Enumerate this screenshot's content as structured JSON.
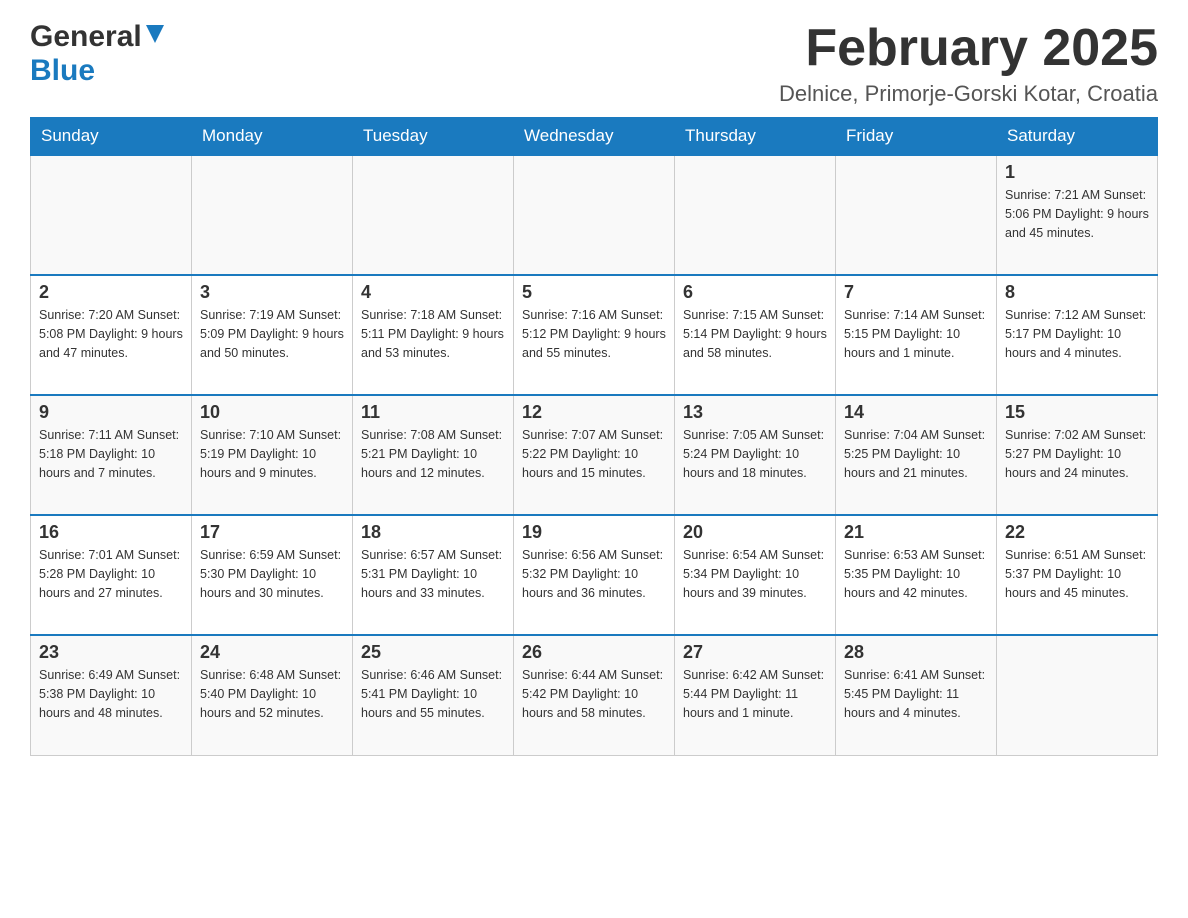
{
  "header": {
    "logo_line1": "General",
    "logo_triangle": "▶",
    "logo_line2": "Blue",
    "month_title": "February 2025",
    "location": "Delnice, Primorje-Gorski Kotar, Croatia"
  },
  "days_of_week": [
    "Sunday",
    "Monday",
    "Tuesday",
    "Wednesday",
    "Thursday",
    "Friday",
    "Saturday"
  ],
  "weeks": [
    [
      {
        "day": "",
        "info": ""
      },
      {
        "day": "",
        "info": ""
      },
      {
        "day": "",
        "info": ""
      },
      {
        "day": "",
        "info": ""
      },
      {
        "day": "",
        "info": ""
      },
      {
        "day": "",
        "info": ""
      },
      {
        "day": "1",
        "info": "Sunrise: 7:21 AM\nSunset: 5:06 PM\nDaylight: 9 hours and 45 minutes."
      }
    ],
    [
      {
        "day": "2",
        "info": "Sunrise: 7:20 AM\nSunset: 5:08 PM\nDaylight: 9 hours and 47 minutes."
      },
      {
        "day": "3",
        "info": "Sunrise: 7:19 AM\nSunset: 5:09 PM\nDaylight: 9 hours and 50 minutes."
      },
      {
        "day": "4",
        "info": "Sunrise: 7:18 AM\nSunset: 5:11 PM\nDaylight: 9 hours and 53 minutes."
      },
      {
        "day": "5",
        "info": "Sunrise: 7:16 AM\nSunset: 5:12 PM\nDaylight: 9 hours and 55 minutes."
      },
      {
        "day": "6",
        "info": "Sunrise: 7:15 AM\nSunset: 5:14 PM\nDaylight: 9 hours and 58 minutes."
      },
      {
        "day": "7",
        "info": "Sunrise: 7:14 AM\nSunset: 5:15 PM\nDaylight: 10 hours and 1 minute."
      },
      {
        "day": "8",
        "info": "Sunrise: 7:12 AM\nSunset: 5:17 PM\nDaylight: 10 hours and 4 minutes."
      }
    ],
    [
      {
        "day": "9",
        "info": "Sunrise: 7:11 AM\nSunset: 5:18 PM\nDaylight: 10 hours and 7 minutes."
      },
      {
        "day": "10",
        "info": "Sunrise: 7:10 AM\nSunset: 5:19 PM\nDaylight: 10 hours and 9 minutes."
      },
      {
        "day": "11",
        "info": "Sunrise: 7:08 AM\nSunset: 5:21 PM\nDaylight: 10 hours and 12 minutes."
      },
      {
        "day": "12",
        "info": "Sunrise: 7:07 AM\nSunset: 5:22 PM\nDaylight: 10 hours and 15 minutes."
      },
      {
        "day": "13",
        "info": "Sunrise: 7:05 AM\nSunset: 5:24 PM\nDaylight: 10 hours and 18 minutes."
      },
      {
        "day": "14",
        "info": "Sunrise: 7:04 AM\nSunset: 5:25 PM\nDaylight: 10 hours and 21 minutes."
      },
      {
        "day": "15",
        "info": "Sunrise: 7:02 AM\nSunset: 5:27 PM\nDaylight: 10 hours and 24 minutes."
      }
    ],
    [
      {
        "day": "16",
        "info": "Sunrise: 7:01 AM\nSunset: 5:28 PM\nDaylight: 10 hours and 27 minutes."
      },
      {
        "day": "17",
        "info": "Sunrise: 6:59 AM\nSunset: 5:30 PM\nDaylight: 10 hours and 30 minutes."
      },
      {
        "day": "18",
        "info": "Sunrise: 6:57 AM\nSunset: 5:31 PM\nDaylight: 10 hours and 33 minutes."
      },
      {
        "day": "19",
        "info": "Sunrise: 6:56 AM\nSunset: 5:32 PM\nDaylight: 10 hours and 36 minutes."
      },
      {
        "day": "20",
        "info": "Sunrise: 6:54 AM\nSunset: 5:34 PM\nDaylight: 10 hours and 39 minutes."
      },
      {
        "day": "21",
        "info": "Sunrise: 6:53 AM\nSunset: 5:35 PM\nDaylight: 10 hours and 42 minutes."
      },
      {
        "day": "22",
        "info": "Sunrise: 6:51 AM\nSunset: 5:37 PM\nDaylight: 10 hours and 45 minutes."
      }
    ],
    [
      {
        "day": "23",
        "info": "Sunrise: 6:49 AM\nSunset: 5:38 PM\nDaylight: 10 hours and 48 minutes."
      },
      {
        "day": "24",
        "info": "Sunrise: 6:48 AM\nSunset: 5:40 PM\nDaylight: 10 hours and 52 minutes."
      },
      {
        "day": "25",
        "info": "Sunrise: 6:46 AM\nSunset: 5:41 PM\nDaylight: 10 hours and 55 minutes."
      },
      {
        "day": "26",
        "info": "Sunrise: 6:44 AM\nSunset: 5:42 PM\nDaylight: 10 hours and 58 minutes."
      },
      {
        "day": "27",
        "info": "Sunrise: 6:42 AM\nSunset: 5:44 PM\nDaylight: 11 hours and 1 minute."
      },
      {
        "day": "28",
        "info": "Sunrise: 6:41 AM\nSunset: 5:45 PM\nDaylight: 11 hours and 4 minutes."
      },
      {
        "day": "",
        "info": ""
      }
    ]
  ]
}
